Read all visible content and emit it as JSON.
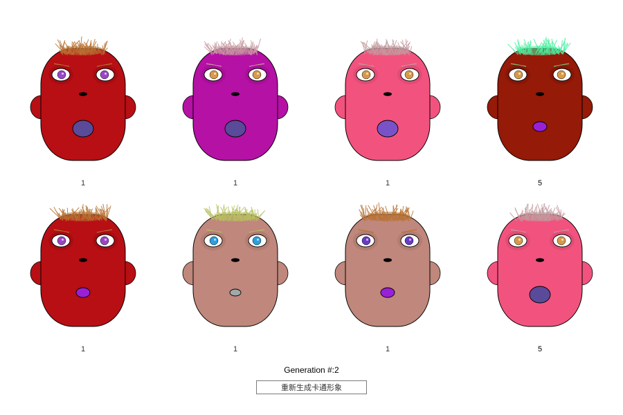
{
  "generation_label": "Generation #:2",
  "regenerate_button": "重新生成卡通形象",
  "faces": [
    {
      "score": "1",
      "skin": "#b80f14",
      "hair": "#b87333",
      "iris": "#9b45c8",
      "mouth": "#5a4a9a",
      "mouth_size": "large",
      "brows": "#b87333",
      "eye_shadow": "#8a0a0e"
    },
    {
      "score": "1",
      "skin": "#b511a5",
      "hair": "#c7999f",
      "iris": "#d89a48",
      "mouth": "#5a4a9a",
      "mouth_size": "large",
      "brows": "#c7999f",
      "eye_shadow": "#8e0a80"
    },
    {
      "score": "1",
      "skin": "#f2537e",
      "hair": "#c29a9e",
      "iris": "#d89a48",
      "mouth": "#7a52c8",
      "mouth_size": "large",
      "brows": "#c29a9e",
      "eye_shadow": "#c24065"
    },
    {
      "score": "5",
      "skin": "#951a07",
      "hair": "#4af0a0",
      "iris": "#d89a48",
      "mouth": "#9a20d8",
      "mouth_size": "small",
      "brows": "#7ac070",
      "eye_shadow": "#6e1205"
    },
    {
      "score": "1",
      "skin": "#b80f14",
      "hair": "#b87333",
      "iris": "#9b45c8",
      "mouth": "#9a20d8",
      "mouth_size": "small",
      "brows": "#b87333",
      "eye_shadow": "#8a0a0e"
    },
    {
      "score": "1",
      "skin": "#c0877c",
      "hair": "#b8c060",
      "iris": "#2aa0e0",
      "mouth": "#a0a8a8",
      "mouth_size": "tiny",
      "brows": "#b8c060",
      "eye_shadow": "#9c6a60"
    },
    {
      "score": "1",
      "skin": "#c0877c",
      "hair": "#b87333",
      "iris": "#6a3ac8",
      "mouth": "#9a20d8",
      "mouth_size": "small",
      "brows": "#b87333",
      "eye_shadow": "#9c6a60"
    },
    {
      "score": "5",
      "skin": "#f2537e",
      "hair": "#c29a9e",
      "iris": "#d89a48",
      "mouth": "#5a4a9a",
      "mouth_size": "large",
      "brows": "#c29a9e",
      "eye_shadow": "#c24065"
    }
  ]
}
